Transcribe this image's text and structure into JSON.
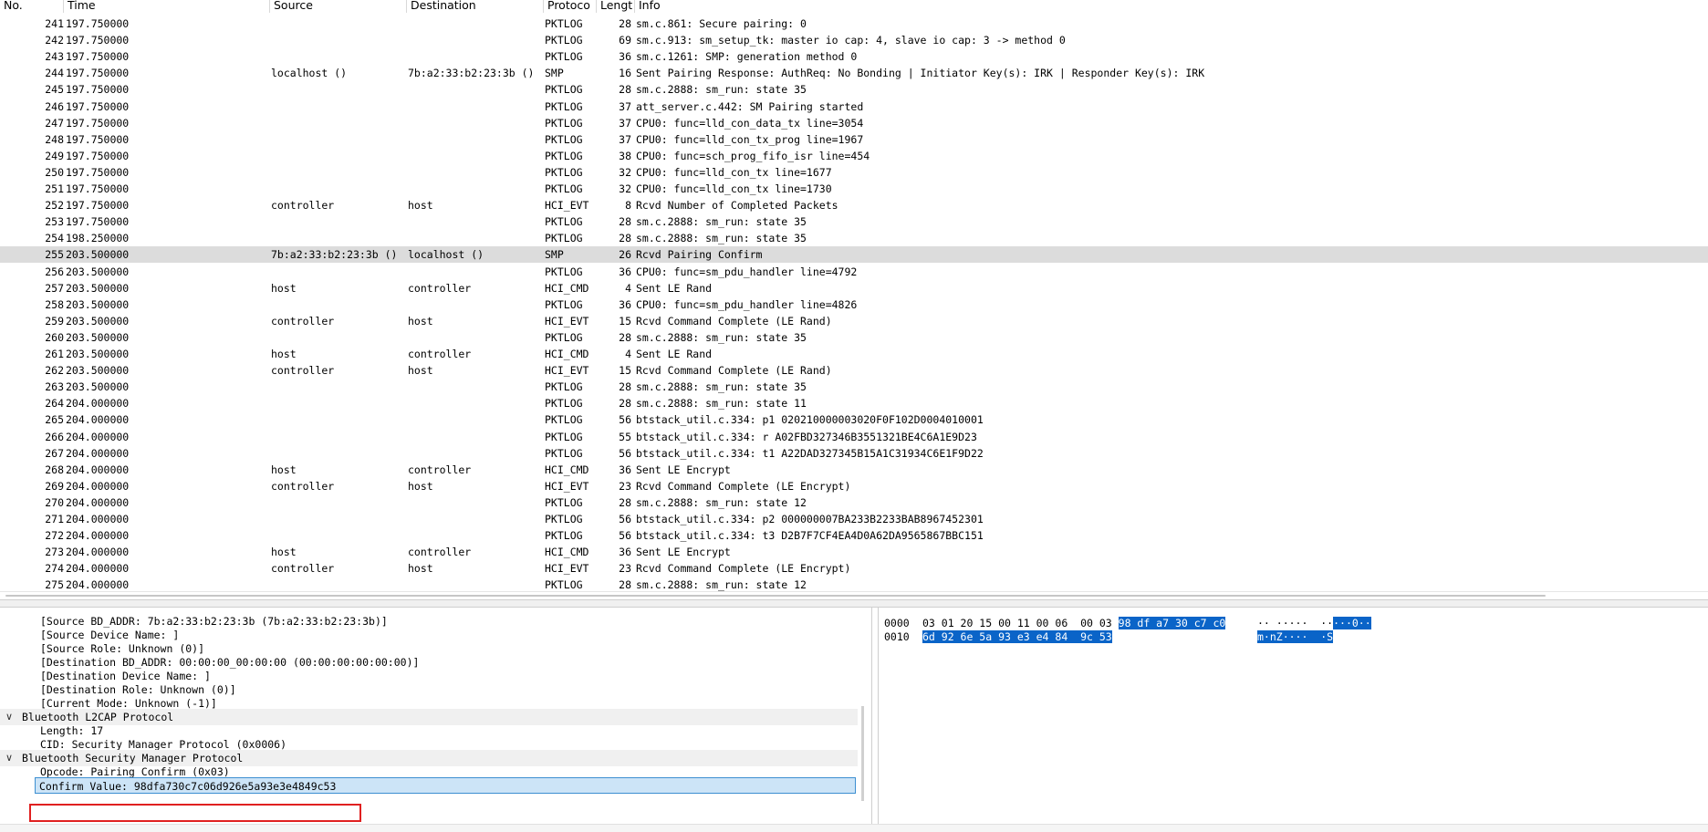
{
  "columns": {
    "no": "No.",
    "time": "Time",
    "source": "Source",
    "destination": "Destination",
    "protocol": "Protoco",
    "length": "Lengt",
    "info": "Info"
  },
  "packets": [
    {
      "no": "241",
      "time": "197.750000",
      "src": "",
      "dst": "",
      "proto": "PKTLOG",
      "len": "28",
      "info": "sm.c.861: Secure pairing: 0"
    },
    {
      "no": "242",
      "time": "197.750000",
      "src": "",
      "dst": "",
      "proto": "PKTLOG",
      "len": "69",
      "info": "sm.c.913: sm_setup_tk: master io cap: 4, slave io cap: 3 -> method 0"
    },
    {
      "no": "243",
      "time": "197.750000",
      "src": "",
      "dst": "",
      "proto": "PKTLOG",
      "len": "36",
      "info": "sm.c.1261: SMP: generation method 0"
    },
    {
      "no": "244",
      "time": "197.750000",
      "src": "localhost ()",
      "dst": "7b:a2:33:b2:23:3b ()",
      "proto": "SMP",
      "len": "16",
      "info": "Sent Pairing Response: AuthReq: No Bonding | Initiator Key(s): IRK | Responder Key(s): IRK"
    },
    {
      "no": "245",
      "time": "197.750000",
      "src": "",
      "dst": "",
      "proto": "PKTLOG",
      "len": "28",
      "info": "sm.c.2888: sm_run: state 35"
    },
    {
      "no": "246",
      "time": "197.750000",
      "src": "",
      "dst": "",
      "proto": "PKTLOG",
      "len": "37",
      "info": "att_server.c.442: SM Pairing started"
    },
    {
      "no": "247",
      "time": "197.750000",
      "src": "",
      "dst": "",
      "proto": "PKTLOG",
      "len": "37",
      "info": "CPU0: func=lld_con_data_tx line=3054"
    },
    {
      "no": "248",
      "time": "197.750000",
      "src": "",
      "dst": "",
      "proto": "PKTLOG",
      "len": "37",
      "info": "CPU0: func=lld_con_tx_prog line=1967"
    },
    {
      "no": "249",
      "time": "197.750000",
      "src": "",
      "dst": "",
      "proto": "PKTLOG",
      "len": "38",
      "info": "CPU0: func=sch_prog_fifo_isr line=454"
    },
    {
      "no": "250",
      "time": "197.750000",
      "src": "",
      "dst": "",
      "proto": "PKTLOG",
      "len": "32",
      "info": "CPU0: func=lld_con_tx line=1677"
    },
    {
      "no": "251",
      "time": "197.750000",
      "src": "",
      "dst": "",
      "proto": "PKTLOG",
      "len": "32",
      "info": "CPU0: func=lld_con_tx line=1730"
    },
    {
      "no": "252",
      "time": "197.750000",
      "src": "controller",
      "dst": "host",
      "proto": "HCI_EVT",
      "len": "8",
      "info": "Rcvd Number of Completed Packets"
    },
    {
      "no": "253",
      "time": "197.750000",
      "src": "",
      "dst": "",
      "proto": "PKTLOG",
      "len": "28",
      "info": "sm.c.2888: sm_run: state 35"
    },
    {
      "no": "254",
      "time": "198.250000",
      "src": "",
      "dst": "",
      "proto": "PKTLOG",
      "len": "28",
      "info": "sm.c.2888: sm_run: state 35"
    },
    {
      "no": "255",
      "time": "203.500000",
      "src": "7b:a2:33:b2:23:3b ()",
      "dst": "localhost ()",
      "proto": "SMP",
      "len": "26",
      "info": "Rcvd Pairing Confirm",
      "selected": true
    },
    {
      "no": "256",
      "time": "203.500000",
      "src": "",
      "dst": "",
      "proto": "PKTLOG",
      "len": "36",
      "info": "CPU0: func=sm_pdu_handler line=4792"
    },
    {
      "no": "257",
      "time": "203.500000",
      "src": "host",
      "dst": "controller",
      "proto": "HCI_CMD",
      "len": "4",
      "info": "Sent LE Rand"
    },
    {
      "no": "258",
      "time": "203.500000",
      "src": "",
      "dst": "",
      "proto": "PKTLOG",
      "len": "36",
      "info": "CPU0: func=sm_pdu_handler line=4826"
    },
    {
      "no": "259",
      "time": "203.500000",
      "src": "controller",
      "dst": "host",
      "proto": "HCI_EVT",
      "len": "15",
      "info": "Rcvd Command Complete (LE Rand)"
    },
    {
      "no": "260",
      "time": "203.500000",
      "src": "",
      "dst": "",
      "proto": "PKTLOG",
      "len": "28",
      "info": "sm.c.2888: sm_run: state 35"
    },
    {
      "no": "261",
      "time": "203.500000",
      "src": "host",
      "dst": "controller",
      "proto": "HCI_CMD",
      "len": "4",
      "info": "Sent LE Rand"
    },
    {
      "no": "262",
      "time": "203.500000",
      "src": "controller",
      "dst": "host",
      "proto": "HCI_EVT",
      "len": "15",
      "info": "Rcvd Command Complete (LE Rand)"
    },
    {
      "no": "263",
      "time": "203.500000",
      "src": "",
      "dst": "",
      "proto": "PKTLOG",
      "len": "28",
      "info": "sm.c.2888: sm_run: state 35"
    },
    {
      "no": "264",
      "time": "204.000000",
      "src": "",
      "dst": "",
      "proto": "PKTLOG",
      "len": "28",
      "info": "sm.c.2888: sm_run: state 11"
    },
    {
      "no": "265",
      "time": "204.000000",
      "src": "",
      "dst": "",
      "proto": "PKTLOG",
      "len": "56",
      "info": "btstack_util.c.334: p1 020210000003020F0F102D0004010001"
    },
    {
      "no": "266",
      "time": "204.000000",
      "src": "",
      "dst": "",
      "proto": "PKTLOG",
      "len": "55",
      "info": "btstack_util.c.334: r A02FBD327346B3551321BE4C6A1E9D23"
    },
    {
      "no": "267",
      "time": "204.000000",
      "src": "",
      "dst": "",
      "proto": "PKTLOG",
      "len": "56",
      "info": "btstack_util.c.334: t1 A22DAD327345B15A1C31934C6E1F9D22"
    },
    {
      "no": "268",
      "time": "204.000000",
      "src": "host",
      "dst": "controller",
      "proto": "HCI_CMD",
      "len": "36",
      "info": "Sent LE Encrypt"
    },
    {
      "no": "269",
      "time": "204.000000",
      "src": "controller",
      "dst": "host",
      "proto": "HCI_EVT",
      "len": "23",
      "info": "Rcvd Command Complete (LE Encrypt)"
    },
    {
      "no": "270",
      "time": "204.000000",
      "src": "",
      "dst": "",
      "proto": "PKTLOG",
      "len": "28",
      "info": "sm.c.2888: sm_run: state 12"
    },
    {
      "no": "271",
      "time": "204.000000",
      "src": "",
      "dst": "",
      "proto": "PKTLOG",
      "len": "56",
      "info": "btstack_util.c.334: p2 000000007BA233B2233BAB8967452301"
    },
    {
      "no": "272",
      "time": "204.000000",
      "src": "",
      "dst": "",
      "proto": "PKTLOG",
      "len": "56",
      "info": "btstack_util.c.334: t3 D2B7F7CF4EA4D0A62DA9565867BBC151"
    },
    {
      "no": "273",
      "time": "204.000000",
      "src": "host",
      "dst": "controller",
      "proto": "HCI_CMD",
      "len": "36",
      "info": "Sent LE Encrypt"
    },
    {
      "no": "274",
      "time": "204.000000",
      "src": "controller",
      "dst": "host",
      "proto": "HCI_EVT",
      "len": "23",
      "info": "Rcvd Command Complete (LE Encrypt)"
    },
    {
      "no": "275",
      "time": "204.000000",
      "src": "",
      "dst": "",
      "proto": "PKTLOG",
      "len": "28",
      "info": "sm.c.2888: sm_run: state 12"
    }
  ],
  "details": [
    {
      "text": "[Source BD_ADDR: 7b:a2:33:b2:23:3b (7b:a2:33:b2:23:3b)]",
      "indent": 2
    },
    {
      "text": "[Source Device Name: ]",
      "indent": 2
    },
    {
      "text": "[Source Role: Unknown (0)]",
      "indent": 2
    },
    {
      "text": "[Destination BD_ADDR: 00:00:00_00:00:00 (00:00:00:00:00:00)]",
      "indent": 2
    },
    {
      "text": "[Destination Device Name: ]",
      "indent": 2
    },
    {
      "text": "[Destination Role: Unknown (0)]",
      "indent": 2
    },
    {
      "text": "[Current Mode: Unknown (-1)]",
      "indent": 2
    },
    {
      "text": "Bluetooth L2CAP Protocol",
      "indent": 1,
      "header": true,
      "chevron": "v"
    },
    {
      "text": "Length: 17",
      "indent": 2
    },
    {
      "text": "CID: Security Manager Protocol (0x0006)",
      "indent": 2
    },
    {
      "text": "Bluetooth Security Manager Protocol",
      "indent": 1,
      "header": true,
      "chevron": "v"
    },
    {
      "text": "Opcode: Pairing Confirm (0x03)",
      "indent": 2
    },
    {
      "text": "Confirm Value: 98dfa730c7c06d926e5a93e3e4849c53",
      "indent": 2,
      "selected": true
    }
  ],
  "bytes": [
    {
      "offset": "0000",
      "hex_plain": "03 01 20 15 00 11 00 06  00 03 ",
      "hex_hl": "98 df a7 30 c7 c0",
      "ascii_plain": "·· ·····  ··",
      "ascii_hl": "···0··"
    },
    {
      "offset": "0010",
      "hex_plain": "",
      "hex_hl": "6d 92 6e 5a 93 e3 e4 84  9c 53",
      "ascii_plain": "",
      "ascii_hl": "m·nZ····  ·S"
    }
  ]
}
